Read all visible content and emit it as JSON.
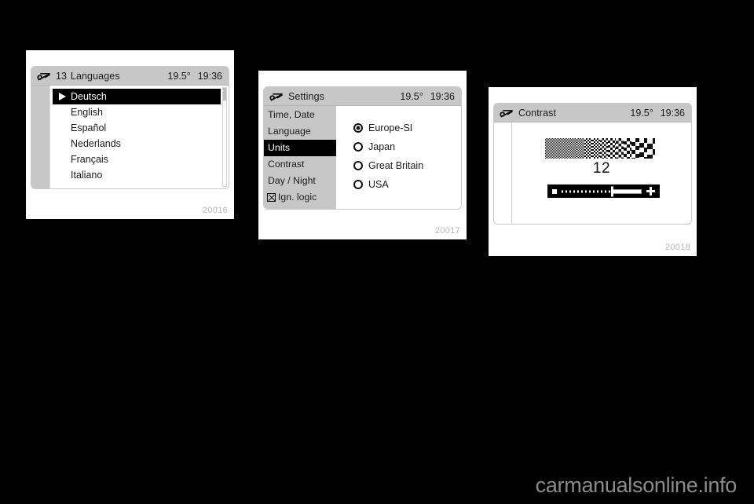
{
  "page": {
    "background_color": "#000000",
    "watermark": "carmanualsonline.info"
  },
  "figures": [
    {
      "caption": "20016",
      "screen": {
        "header": {
          "icon": "wrench-settings-icon",
          "index": "13",
          "title": "Languages",
          "temperature": "19.5°",
          "clock": "19:36"
        },
        "list": [
          {
            "label": "Deutsch",
            "selected": true
          },
          {
            "label": "English",
            "selected": false
          },
          {
            "label": "Español",
            "selected": false
          },
          {
            "label": "Nederlands",
            "selected": false
          },
          {
            "label": "Français",
            "selected": false
          },
          {
            "label": "Italiano",
            "selected": false
          }
        ]
      }
    },
    {
      "caption": "20017",
      "screen": {
        "header": {
          "icon": "wrench-settings-icon",
          "title": "Settings",
          "temperature": "19.5°",
          "clock": "19:36"
        },
        "menu": [
          {
            "label": "Time, Date",
            "selected": false,
            "checkbox": false
          },
          {
            "label": "Language",
            "selected": false,
            "checkbox": false
          },
          {
            "label": "Units",
            "selected": true,
            "checkbox": false
          },
          {
            "label": "Contrast",
            "selected": false,
            "checkbox": false
          },
          {
            "label": "Day / Night",
            "selected": false,
            "checkbox": false
          },
          {
            "label": "Ign. logic",
            "selected": false,
            "checkbox": true
          }
        ],
        "options": [
          {
            "label": "Europe-SI",
            "selected": true
          },
          {
            "label": "Japan",
            "selected": false
          },
          {
            "label": "Great Britain",
            "selected": false
          },
          {
            "label": "USA",
            "selected": false
          }
        ]
      }
    },
    {
      "caption": "20018",
      "screen": {
        "header": {
          "icon": "wrench-settings-icon",
          "title": "Contrast",
          "temperature": "19.5°",
          "clock": "19:36"
        },
        "contrast": {
          "value": "12",
          "slider": {
            "minus_label": "minus-icon",
            "plus_label": "plus-icon",
            "percent": 62
          }
        }
      }
    }
  ]
}
